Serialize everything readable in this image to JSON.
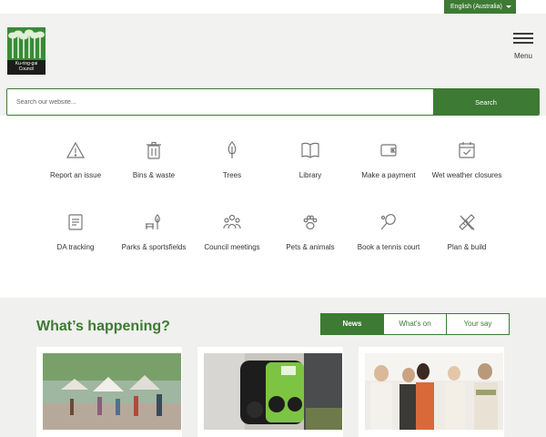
{
  "language": {
    "selected": "English (Australia)"
  },
  "logo": {
    "line1": "Ku-ring-gai",
    "line2": "Council"
  },
  "menu": {
    "label": "Menu"
  },
  "search": {
    "placeholder": "Search our website...",
    "button_label": "Search"
  },
  "quick_links": [
    {
      "label": "Report an issue",
      "icon": "warning-icon"
    },
    {
      "label": "Bins & waste",
      "icon": "bin-icon"
    },
    {
      "label": "Trees",
      "icon": "tree-icon"
    },
    {
      "label": "Library",
      "icon": "book-icon"
    },
    {
      "label": "Make a payment",
      "icon": "wallet-icon"
    },
    {
      "label": "Wet weather closures",
      "icon": "calendar-check-icon"
    },
    {
      "label": "DA tracking",
      "icon": "document-list-icon"
    },
    {
      "label": "Parks & sportsfields",
      "icon": "park-bench-icon"
    },
    {
      "label": "Council meetings",
      "icon": "people-group-icon"
    },
    {
      "label": "Pets & animals",
      "icon": "paw-icon"
    },
    {
      "label": "Book a tennis court",
      "icon": "tennis-racket-icon"
    },
    {
      "label": "Plan & build",
      "icon": "ruler-pencil-icon"
    }
  ],
  "happening": {
    "title": "What’s happening?",
    "tabs": [
      {
        "label": "News",
        "active": true
      },
      {
        "label": "What's on",
        "active": false
      },
      {
        "label": "Your say",
        "active": false
      }
    ]
  },
  "colors": {
    "brand_green": "#3d7a34",
    "header_bg": "#f2f2f0",
    "section_bg": "#f0f0ee"
  }
}
